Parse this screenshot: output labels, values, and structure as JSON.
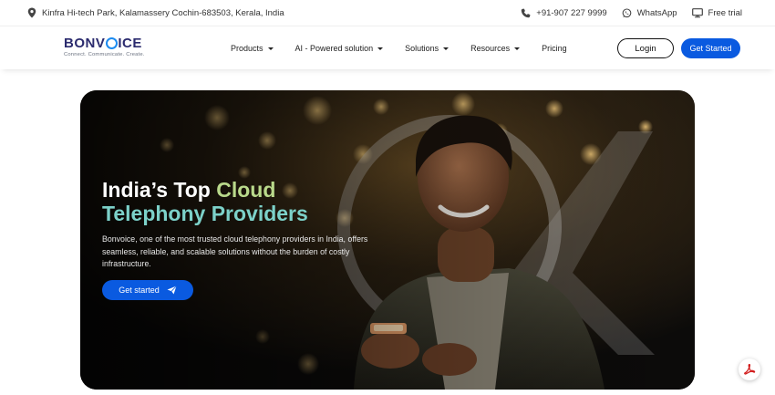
{
  "topbar": {
    "address": "Kinfra Hi-tech Park, Kalamassery Cochin-683503, Kerala, India",
    "phone": "+91-907 227 9999",
    "whatsapp": "WhatsApp",
    "free_trial": "Free trial"
  },
  "logo": {
    "word_pre": "BONV",
    "word_post": "ICE",
    "tagline": "Connect. Communicate. Create."
  },
  "nav": {
    "items": [
      {
        "label": "Products",
        "has_dropdown": true
      },
      {
        "label": "AI - Powered solution",
        "has_dropdown": true
      },
      {
        "label": "Solutions",
        "has_dropdown": true
      },
      {
        "label": "Resources",
        "has_dropdown": true
      },
      {
        "label": "Pricing",
        "has_dropdown": false
      }
    ],
    "login_label": "Login",
    "get_started_label": "Get Started"
  },
  "hero": {
    "title_white_1": "India’s Top ",
    "title_green_1": "Cloud",
    "title_green_2": "Telephony Providers",
    "description": "Bonvoice, one of the most trusted cloud telephony providers in India, offers seamless, reliable, and scalable solutions without the burden of costly infrastructure.",
    "cta_label": "Get started"
  },
  "colors": {
    "primary_blue": "#0a5ae0",
    "title_green": "#b9d98b",
    "title_teal": "#7cd1c9",
    "logo_navy": "#2b2b6e"
  }
}
